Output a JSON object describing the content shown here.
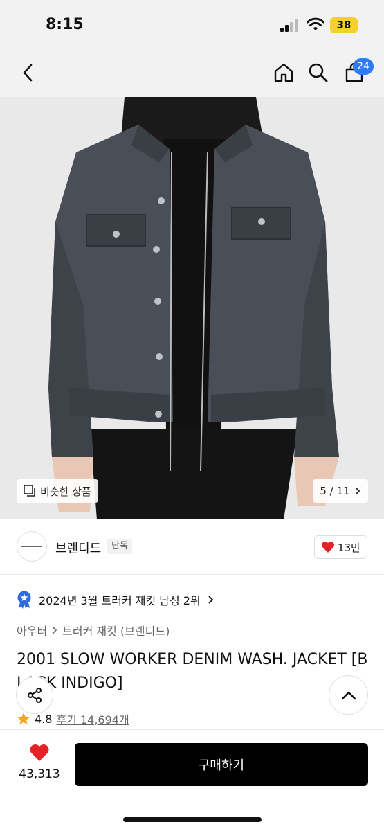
{
  "status_bar": {
    "time": "8:15",
    "battery": "38"
  },
  "header": {
    "cart_count": "24"
  },
  "gallery": {
    "similar_label": "비슷한 상품",
    "page_indicator": "5 / 11"
  },
  "brand": {
    "name": "브랜디드",
    "tag": "단독",
    "likes": "13만"
  },
  "ranking": {
    "text": "2024년 3월 트러커 재킷 남성 2위"
  },
  "breadcrumb": {
    "category": "아우터",
    "subcategory": "트러커 재킷 (브랜디드)"
  },
  "product": {
    "title": "2001 SLOW WORKER DENIM WASH. JACKET [BLACK INDIGO]"
  },
  "rating": {
    "score": "4.8",
    "reviews": "후기 14,694개"
  },
  "bottom": {
    "wish_count": "43,313",
    "buy_label": "구매하기"
  },
  "colors": {
    "accent_blue": "#2f7bf5",
    "heart_red": "#e6212a",
    "star": "#f5a623",
    "buy_bg": "#000000"
  }
}
